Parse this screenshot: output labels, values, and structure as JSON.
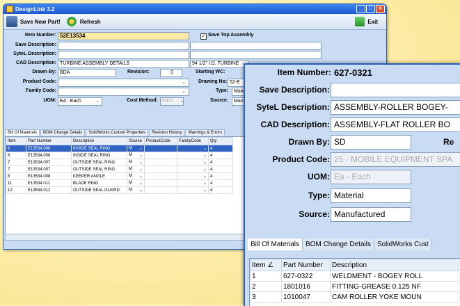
{
  "window": {
    "title": "DesignLink 3.2",
    "min": "_",
    "max": "□",
    "close": "✕"
  },
  "toolbar": {
    "save_label": "Save New Part!",
    "refresh_label": "Refresh",
    "exit_label": "Exit"
  },
  "form": {
    "item_number_label": "Item Number:",
    "item_number": "52E13534",
    "save_top_label": "Save Top Assembly",
    "save_top_checked": "✓",
    "save_desc_label": "Save Description:",
    "save_desc": "",
    "sytel_desc_label": "SyteL Description:",
    "sytel_desc": "",
    "cad_desc_label": "CAD Description:",
    "cad_desc": "TURBINE ASSEMBLY DETAILS",
    "cad_desc2": "94 1/2\" I.D. TURBINE",
    "drawn_by_label": "Drawn By:",
    "drawn_by": "BDA",
    "revision_label": "Revision:",
    "revision": "0",
    "starting_wc_label": "Starting WC:",
    "product_code_label": "Product Code:",
    "product_code": "",
    "drawing_no_label": "Drawing No:",
    "drawing_no": "52-E",
    "family_code_label": "Family Code:",
    "family_code": "",
    "type_label": "Type:",
    "type": "Mate",
    "uom_label": "UOM:",
    "uom": "EA : Each",
    "cost_method_label": "Cost Method:",
    "cost_method": "FIFO",
    "source_label": "Source:",
    "source": "Manu"
  },
  "tabs": [
    "Bill Of Materials",
    "BOM Change Details",
    "SolidWorks Custom Properties",
    "Revision History",
    "Warnings & Errors"
  ],
  "grid": {
    "headers": [
      "Item",
      "Part Number",
      "Description",
      "Source",
      "ProductCode",
      "FamilyCode",
      "Qty"
    ],
    "rows": [
      [
        "6",
        "E13534.006",
        "INSIDE SEAL RING",
        "M",
        "",
        "",
        "4"
      ],
      [
        "6",
        "E13534.006",
        "INSIDE SEAL RING",
        "M",
        "",
        "",
        "4"
      ],
      [
        "7",
        "E13534.007",
        "OUTSIDE SEAL RING",
        "M",
        "",
        "",
        "4"
      ],
      [
        "7",
        "E13534.007",
        "OUTSIDE SEAL RING",
        "M",
        "",
        "",
        "4"
      ],
      [
        "8",
        "E13534.008",
        "KEEPER ANGLE",
        "M",
        "",
        "",
        "4"
      ],
      [
        "11",
        "E13534.011",
        "BLADE RING",
        "M",
        "",
        "",
        "4"
      ],
      [
        "12",
        "E13534.012",
        "OUTSIDE SEAL GUARD",
        "M",
        "",
        "",
        "4"
      ]
    ]
  },
  "zoom": {
    "item_number_label": "Item Number:",
    "item_number": "627-0321",
    "save_desc_label": "Save Description:",
    "save_desc": "",
    "sytel_desc_label": "SyteL Description:",
    "sytel_desc": "ASSEMBLY-ROLLER BOGEY-",
    "cad_desc_label": "CAD Description:",
    "cad_desc": "ASSEMBLY-FLAT ROLLER BO",
    "drawn_by_label": "Drawn By:",
    "drawn_by": "SD",
    "re_label": "Re",
    "product_code_label": "Product Code:",
    "product_code": "25 - MOBILE EQUIPMENT SPA",
    "uom_label": "UOM:",
    "uom": "Ea - Each",
    "type_label": "Type:",
    "type": "Material",
    "source_label": "Source:",
    "source": "Manufactured",
    "tabs": [
      "Bill Of Materials",
      "BOM Change Details",
      "SolidWorks Cust"
    ],
    "headers": [
      "Item",
      "Part Number",
      "Description"
    ],
    "sort_indicator": "∠",
    "rows": [
      [
        "1",
        "627-0322",
        "WELDMENT - BOGEY ROLL"
      ],
      [
        "2",
        "1801016",
        "FITTING-GREASE 0.125 NF"
      ],
      [
        "3",
        "1010047",
        "CAM ROLLER YOKE MOUN"
      ]
    ]
  }
}
